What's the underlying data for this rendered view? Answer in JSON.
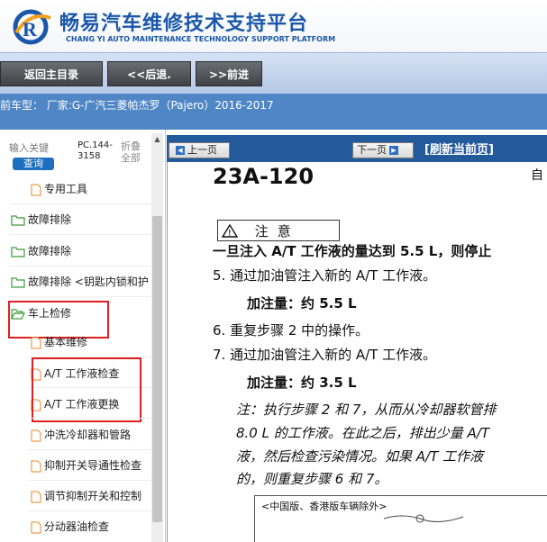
{
  "header": {
    "title": "畅易汽车维修技术支持平台",
    "subtitle": "CHANG YI AUTO MAINTENANCE TECHNOLOGY SUPPORT PLATFORM",
    "logo_icon": "cy-logo-icon"
  },
  "toolbar": {
    "home_label": "返回主目录",
    "back_label": "<<后退.",
    "forward_label": ">>前进"
  },
  "model_bar": {
    "text": "前车型： 厂家:G-广汽三菱帕杰罗（Pajero）2016-2017"
  },
  "left_panel": {
    "search_hint": "输入关键",
    "search_button": "查询",
    "pc_line1": "PC.144-",
    "pc_line2": "3158",
    "collapse_line1": "折叠",
    "collapse_line2": "全部"
  },
  "tree": {
    "items": [
      {
        "label": "专用工具",
        "type": "doc"
      },
      {
        "label": "故障排除",
        "type": "folder"
      },
      {
        "label": "故障排除",
        "type": "folder"
      },
      {
        "label": "故障排除 <钥匙内锁和护",
        "type": "folder"
      },
      {
        "label": "车上检修",
        "type": "folder-open"
      },
      {
        "label": "基本维修",
        "type": "doc"
      },
      {
        "label": "A/T 工作液检查",
        "type": "doc"
      },
      {
        "label": "A/T 工作液更换",
        "type": "doc"
      },
      {
        "label": "冲洗冷却器和管路",
        "type": "doc"
      },
      {
        "label": "抑制开关导通性检查",
        "type": "doc"
      },
      {
        "label": "调节抑制开关和控制",
        "type": "doc"
      },
      {
        "label": "分动器油检查",
        "type": "doc"
      }
    ]
  },
  "viewer": {
    "prev_label": "上一页",
    "next_label": "下一页",
    "refresh_label": "[刷新当前页]"
  },
  "document": {
    "code": "23A-120",
    "code_side": "自",
    "warning_title": "注意",
    "line1": "一旦注入 A/T 工作液的量达到 5.5 L，则停止",
    "line2": "5. 通过加油管注入新的 A/T 工作液。",
    "line3": "加注量：约 5.5 L",
    "line4": "6. 重复步骤 2 中的操作。",
    "line5": "7. 通过加油管注入新的 A/T 工作液。",
    "line6": "加注量：约 3.5 L",
    "note1": "注：执行步骤 2 和 7，从而从冷却器软管排",
    "note2": "8.0 L 的工作液。在此之后，排出少量 A/T",
    "note3": "液，然后检查污染情况。如果 A/T 工作液",
    "note4": "的，则重复步骤 6 和 7。",
    "figure_caption": "<中国版、香港版车辆除外>"
  },
  "colors": {
    "brand_blue": "#1a57a8",
    "model_bar": "#4f86c6",
    "nav_bar": "#235a9c",
    "highlight_red": "#e02020",
    "folder_green": "#3c9a3c",
    "doc_orange": "#e8872a"
  }
}
